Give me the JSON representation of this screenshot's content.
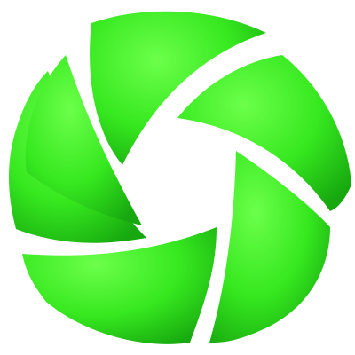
{
  "logo": {
    "icon": "shutter-swirl-logo-icon",
    "blade_count": 6,
    "colors": {
      "highlight": "#6cff4a",
      "base": "#36e81f",
      "shade": "#17a80f",
      "background": "#ffffff"
    }
  }
}
